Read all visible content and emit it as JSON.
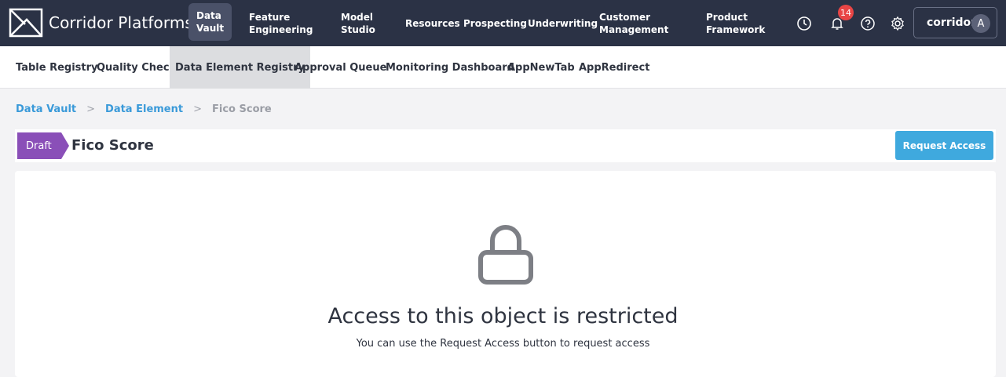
{
  "app": {
    "name": "Corridor Platforms"
  },
  "topnav": {
    "items": [
      {
        "label": "Data\nVault"
      },
      {
        "label": "Feature\nEngineering"
      },
      {
        "label": "Model\nStudio"
      },
      {
        "label": "Resources"
      },
      {
        "label": "Prospecting"
      },
      {
        "label": "Underwriting"
      },
      {
        "label": "Customer\nManagement"
      },
      {
        "label": "Product\nFramework"
      }
    ],
    "notification_count": "14",
    "user_label": "corridor",
    "avatar_initial": "A",
    "icons": [
      "history-icon",
      "bell-icon",
      "help-icon",
      "gear-icon"
    ]
  },
  "subnav": {
    "items": [
      {
        "label": "Table Registry"
      },
      {
        "label": "Quality Check"
      },
      {
        "label": "Data Element Registry"
      },
      {
        "label": "Approval Queue"
      },
      {
        "label": "Monitoring Dashboard"
      },
      {
        "label": "AppNewTab"
      },
      {
        "label": "AppRedirect"
      }
    ]
  },
  "breadcrumb": {
    "root": "Data Vault",
    "parent": "Data Element",
    "current": "Fico Score"
  },
  "header": {
    "status": "Draft",
    "title": "Fico Score",
    "request_label": "Request Access"
  },
  "restricted": {
    "title": "Access to this object is restricted",
    "message": "You can use the Request Access button to request access"
  },
  "colors": {
    "nav_bg": "#2b3245",
    "accent": "#3fa9de",
    "draft": "#8a4fb8",
    "badge": "#e84545"
  }
}
